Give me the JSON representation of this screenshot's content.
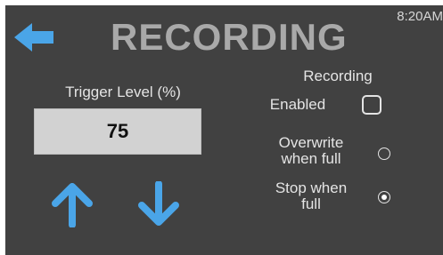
{
  "header": {
    "title": "RECORDING",
    "clock": "8:20AM"
  },
  "trigger": {
    "label": "Trigger Level (%)",
    "value": "75"
  },
  "recording": {
    "heading": "Recording",
    "enabled_label": "Enabled",
    "enabled": false,
    "options": [
      {
        "label_line1": "Overwrite",
        "label_line2": "when full",
        "selected": false
      },
      {
        "label_line1": "Stop when",
        "label_line2": "full",
        "selected": true
      }
    ]
  },
  "icons": {
    "back": "back-arrow-icon",
    "increase": "arrow-up-icon",
    "decrease": "arrow-down-icon"
  },
  "colors": {
    "background": "#414141",
    "accent": "#4aa5e8",
    "title": "#a9a9a9",
    "field": "#d2d2d2"
  }
}
